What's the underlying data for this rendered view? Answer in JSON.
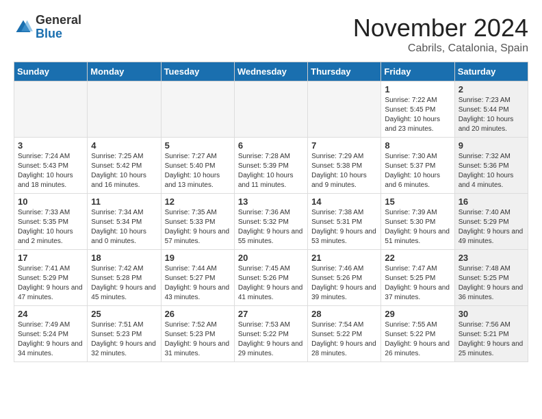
{
  "header": {
    "logo_general": "General",
    "logo_blue": "Blue",
    "month_title": "November 2024",
    "location": "Cabrils, Catalonia, Spain"
  },
  "weekdays": [
    "Sunday",
    "Monday",
    "Tuesday",
    "Wednesday",
    "Thursday",
    "Friday",
    "Saturday"
  ],
  "weeks": [
    [
      {
        "day": "",
        "info": "",
        "empty": true
      },
      {
        "day": "",
        "info": "",
        "empty": true
      },
      {
        "day": "",
        "info": "",
        "empty": true
      },
      {
        "day": "",
        "info": "",
        "empty": true
      },
      {
        "day": "",
        "info": "",
        "empty": true
      },
      {
        "day": "1",
        "info": "Sunrise: 7:22 AM\nSunset: 5:45 PM\nDaylight: 10 hours\nand 23 minutes.",
        "shaded": false
      },
      {
        "day": "2",
        "info": "Sunrise: 7:23 AM\nSunset: 5:44 PM\nDaylight: 10 hours\nand 20 minutes.",
        "shaded": true
      }
    ],
    [
      {
        "day": "3",
        "info": "Sunrise: 7:24 AM\nSunset: 5:43 PM\nDaylight: 10 hours\nand 18 minutes.",
        "shaded": false
      },
      {
        "day": "4",
        "info": "Sunrise: 7:25 AM\nSunset: 5:42 PM\nDaylight: 10 hours\nand 16 minutes.",
        "shaded": false
      },
      {
        "day": "5",
        "info": "Sunrise: 7:27 AM\nSunset: 5:40 PM\nDaylight: 10 hours\nand 13 minutes.",
        "shaded": false
      },
      {
        "day": "6",
        "info": "Sunrise: 7:28 AM\nSunset: 5:39 PM\nDaylight: 10 hours\nand 11 minutes.",
        "shaded": false
      },
      {
        "day": "7",
        "info": "Sunrise: 7:29 AM\nSunset: 5:38 PM\nDaylight: 10 hours\nand 9 minutes.",
        "shaded": false
      },
      {
        "day": "8",
        "info": "Sunrise: 7:30 AM\nSunset: 5:37 PM\nDaylight: 10 hours\nand 6 minutes.",
        "shaded": false
      },
      {
        "day": "9",
        "info": "Sunrise: 7:32 AM\nSunset: 5:36 PM\nDaylight: 10 hours\nand 4 minutes.",
        "shaded": true
      }
    ],
    [
      {
        "day": "10",
        "info": "Sunrise: 7:33 AM\nSunset: 5:35 PM\nDaylight: 10 hours\nand 2 minutes.",
        "shaded": false
      },
      {
        "day": "11",
        "info": "Sunrise: 7:34 AM\nSunset: 5:34 PM\nDaylight: 10 hours\nand 0 minutes.",
        "shaded": false
      },
      {
        "day": "12",
        "info": "Sunrise: 7:35 AM\nSunset: 5:33 PM\nDaylight: 9 hours\nand 57 minutes.",
        "shaded": false
      },
      {
        "day": "13",
        "info": "Sunrise: 7:36 AM\nSunset: 5:32 PM\nDaylight: 9 hours\nand 55 minutes.",
        "shaded": false
      },
      {
        "day": "14",
        "info": "Sunrise: 7:38 AM\nSunset: 5:31 PM\nDaylight: 9 hours\nand 53 minutes.",
        "shaded": false
      },
      {
        "day": "15",
        "info": "Sunrise: 7:39 AM\nSunset: 5:30 PM\nDaylight: 9 hours\nand 51 minutes.",
        "shaded": false
      },
      {
        "day": "16",
        "info": "Sunrise: 7:40 AM\nSunset: 5:29 PM\nDaylight: 9 hours\nand 49 minutes.",
        "shaded": true
      }
    ],
    [
      {
        "day": "17",
        "info": "Sunrise: 7:41 AM\nSunset: 5:29 PM\nDaylight: 9 hours\nand 47 minutes.",
        "shaded": false
      },
      {
        "day": "18",
        "info": "Sunrise: 7:42 AM\nSunset: 5:28 PM\nDaylight: 9 hours\nand 45 minutes.",
        "shaded": false
      },
      {
        "day": "19",
        "info": "Sunrise: 7:44 AM\nSunset: 5:27 PM\nDaylight: 9 hours\nand 43 minutes.",
        "shaded": false
      },
      {
        "day": "20",
        "info": "Sunrise: 7:45 AM\nSunset: 5:26 PM\nDaylight: 9 hours\nand 41 minutes.",
        "shaded": false
      },
      {
        "day": "21",
        "info": "Sunrise: 7:46 AM\nSunset: 5:26 PM\nDaylight: 9 hours\nand 39 minutes.",
        "shaded": false
      },
      {
        "day": "22",
        "info": "Sunrise: 7:47 AM\nSunset: 5:25 PM\nDaylight: 9 hours\nand 37 minutes.",
        "shaded": false
      },
      {
        "day": "23",
        "info": "Sunrise: 7:48 AM\nSunset: 5:25 PM\nDaylight: 9 hours\nand 36 minutes.",
        "shaded": true
      }
    ],
    [
      {
        "day": "24",
        "info": "Sunrise: 7:49 AM\nSunset: 5:24 PM\nDaylight: 9 hours\nand 34 minutes.",
        "shaded": false
      },
      {
        "day": "25",
        "info": "Sunrise: 7:51 AM\nSunset: 5:23 PM\nDaylight: 9 hours\nand 32 minutes.",
        "shaded": false
      },
      {
        "day": "26",
        "info": "Sunrise: 7:52 AM\nSunset: 5:23 PM\nDaylight: 9 hours\nand 31 minutes.",
        "shaded": false
      },
      {
        "day": "27",
        "info": "Sunrise: 7:53 AM\nSunset: 5:22 PM\nDaylight: 9 hours\nand 29 minutes.",
        "shaded": false
      },
      {
        "day": "28",
        "info": "Sunrise: 7:54 AM\nSunset: 5:22 PM\nDaylight: 9 hours\nand 28 minutes.",
        "shaded": false
      },
      {
        "day": "29",
        "info": "Sunrise: 7:55 AM\nSunset: 5:22 PM\nDaylight: 9 hours\nand 26 minutes.",
        "shaded": false
      },
      {
        "day": "30",
        "info": "Sunrise: 7:56 AM\nSunset: 5:21 PM\nDaylight: 9 hours\nand 25 minutes.",
        "shaded": true
      }
    ]
  ]
}
